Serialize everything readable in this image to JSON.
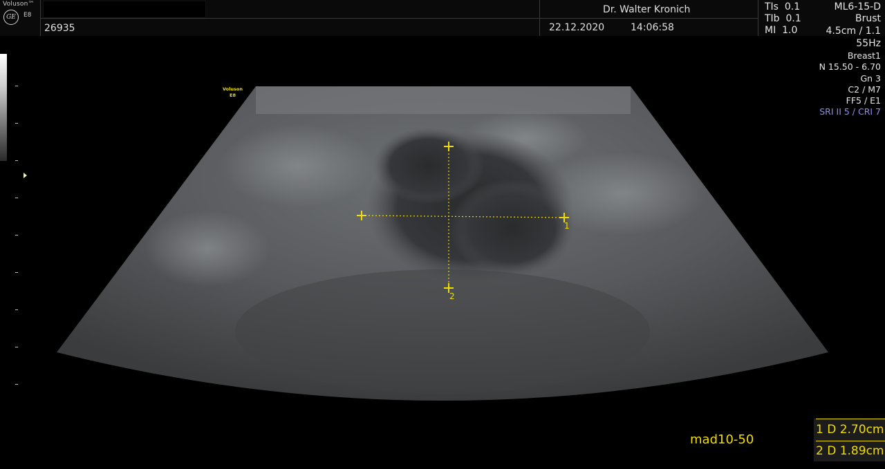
{
  "header": {
    "logo_brand": "Voluson™",
    "logo_ge": "GE",
    "logo_model": "E8",
    "patient_id": "26935",
    "doctor": "Dr. Walter Kronich",
    "date": "22.12.2020",
    "time": "14:06:58"
  },
  "indices": [
    {
      "label": "TIs",
      "value": "0.1"
    },
    {
      "label": "TIb",
      "value": "0.1"
    },
    {
      "label": "MI",
      "value": "1.0"
    }
  ],
  "probe_settings": [
    {
      "text": "ML6-15-D",
      "style": "ri14"
    },
    {
      "text": "Brust",
      "style": "ri14"
    },
    {
      "text": "4.5cm / 1.1",
      "style": "ri14"
    },
    {
      "text": "55Hz",
      "style": "ri14"
    },
    {
      "text": "Breast1",
      "style": "ri13"
    },
    {
      "text": "N 15.50 - 6.70",
      "style": "ri13"
    },
    {
      "text": "Gn  3",
      "style": "ri13"
    },
    {
      "text": "C2 / M7",
      "style": "ri13"
    },
    {
      "text": "FF5 / E1",
      "style": "ri13"
    },
    {
      "text": "SRI II 5 / CRI 7",
      "style": "ri13 ri-blue"
    }
  ],
  "image_logo": {
    "line1": "Voluson",
    "line2": "E8"
  },
  "calipers": [
    {
      "id": "1",
      "label": "1"
    },
    {
      "id": "2",
      "label": "2"
    }
  ],
  "scan_label": "mad10-50",
  "measurements": [
    {
      "label": "1 D 2.70cm"
    },
    {
      "label": "2 D 1.89cm"
    }
  ],
  "colors": {
    "caliper": "#f2dd00",
    "accent_blue": "#8e8ef5"
  }
}
